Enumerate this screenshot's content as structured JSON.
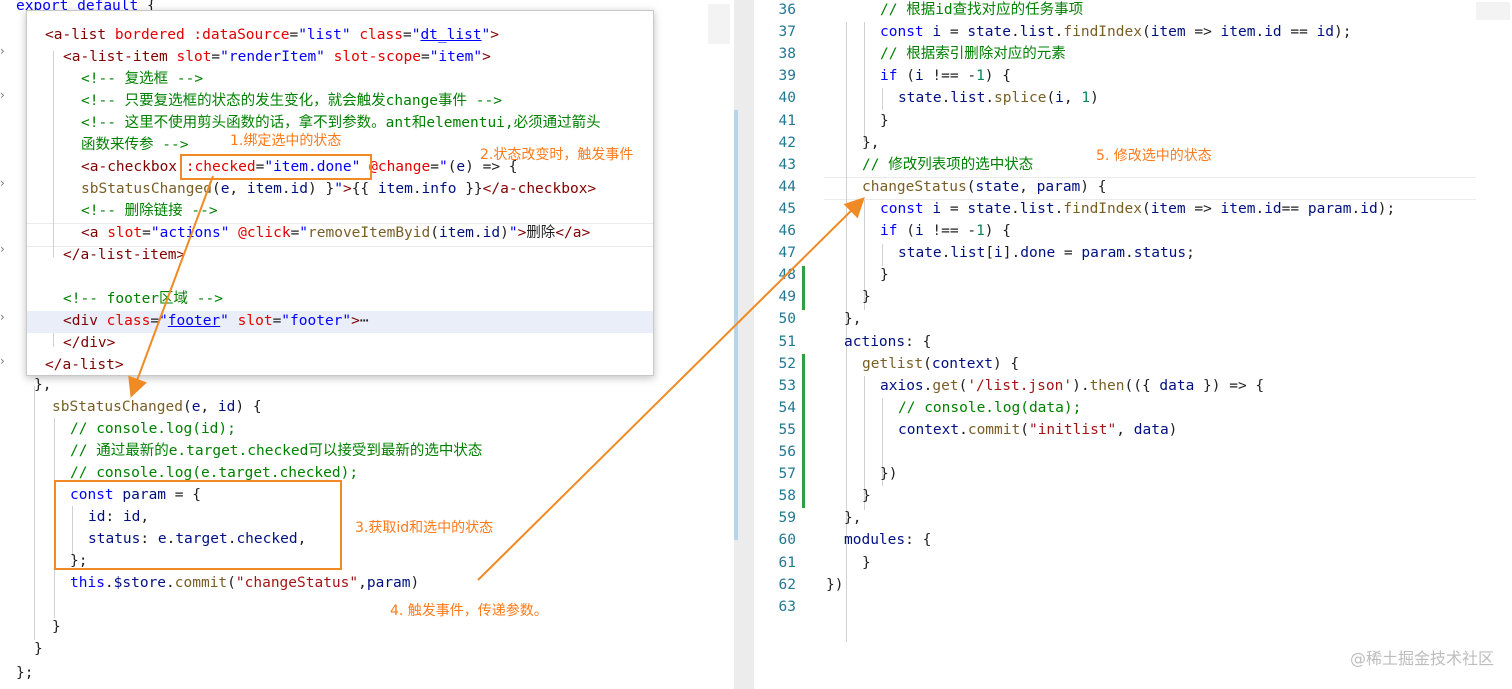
{
  "left_editor": {
    "top_line": [
      [
        "k",
        "export"
      ],
      [
        "p",
        " "
      ],
      [
        "k",
        "default"
      ],
      [
        "p",
        " {"
      ]
    ],
    "bottom_line": [
      [
        "p",
        "};"
      ]
    ],
    "method_lines": [
      [
        [
          "p",
          "},"
        ]
      ],
      [
        [
          "f",
          "sbStatusChanged"
        ],
        [
          "p",
          "("
        ],
        [
          "v",
          "e"
        ],
        [
          "p",
          ", "
        ],
        [
          "v",
          "id"
        ],
        [
          "p",
          ") {"
        ]
      ],
      [
        [
          "c",
          "// console.log(id);"
        ]
      ],
      [
        [
          "c",
          "// 通过最新的e.target.checked可以接受到最新的选中状态"
        ]
      ],
      [
        [
          "c",
          "// console.log(e.target.checked);"
        ]
      ],
      [
        [
          "k",
          "const"
        ],
        [
          "p",
          " "
        ],
        [
          "v",
          "param"
        ],
        [
          "p",
          " = {"
        ]
      ],
      [
        [
          "v",
          "id"
        ],
        [
          "p",
          ": "
        ],
        [
          "v",
          "id"
        ],
        [
          "p",
          ","
        ]
      ],
      [
        [
          "v",
          "status"
        ],
        [
          "p",
          ": "
        ],
        [
          "v",
          "e"
        ],
        [
          "p",
          "."
        ],
        [
          "v",
          "target"
        ],
        [
          "p",
          "."
        ],
        [
          "v",
          "checked"
        ],
        [
          "p",
          ","
        ]
      ],
      [
        [
          "p",
          "};"
        ]
      ],
      [
        [
          "k",
          "this"
        ],
        [
          "p",
          "."
        ],
        [
          "v",
          "$store"
        ],
        [
          "p",
          "."
        ],
        [
          "f",
          "commit"
        ],
        [
          "p",
          "("
        ],
        [
          "s",
          "\"changeStatus\""
        ],
        [
          "p",
          ","
        ],
        [
          "v",
          "param"
        ],
        [
          "p",
          ")"
        ]
      ],
      [
        [
          "p",
          ""
        ]
      ],
      [
        [
          "p",
          "}"
        ]
      ],
      [
        [
          "p",
          "}"
        ]
      ]
    ]
  },
  "popup": {
    "lines": [
      [
        [
          "t",
          "<a-list"
        ],
        [
          "p",
          " "
        ],
        [
          "a",
          "bordered"
        ],
        [
          "p",
          " "
        ],
        [
          "a",
          ":dataSource"
        ],
        [
          "p",
          "="
        ],
        [
          "k",
          "\"list\""
        ],
        [
          "p",
          " "
        ],
        [
          "a",
          "class"
        ],
        [
          "p",
          "="
        ],
        [
          "k",
          "\""
        ],
        [
          "ku",
          "dt_list"
        ],
        [
          "k",
          "\""
        ],
        [
          "t",
          ">"
        ]
      ],
      [
        [
          "t",
          "<a-list-item"
        ],
        [
          "p",
          " "
        ],
        [
          "a",
          "slot"
        ],
        [
          "p",
          "="
        ],
        [
          "k",
          "\"renderItem\""
        ],
        [
          "p",
          " "
        ],
        [
          "a",
          "slot-scope"
        ],
        [
          "p",
          "="
        ],
        [
          "k",
          "\"item\""
        ],
        [
          "t",
          ">"
        ]
      ],
      [
        [
          "c",
          "<!-- 复选框 -->"
        ]
      ],
      [
        [
          "c",
          "<!-- 只要复选框的状态的发生变化，就会触发change事件 -->"
        ]
      ],
      [
        [
          "c",
          "<!-- 这里不使用剪头函数的话，拿不到参数。ant和elementui,必须通过箭头"
        ]
      ],
      [
        [
          "c",
          "函数来传参 -->"
        ]
      ],
      [
        [
          "t",
          "<a-checkbox"
        ],
        [
          "p",
          " "
        ],
        [
          "a",
          ":checked"
        ],
        [
          "p",
          "="
        ],
        [
          "k",
          "\"item.done\""
        ],
        [
          "p",
          " "
        ],
        [
          "a",
          "@change"
        ],
        [
          "p",
          "="
        ],
        [
          "k",
          "\""
        ],
        [
          "p",
          "("
        ],
        [
          "v",
          "e"
        ],
        [
          "p",
          ") => {"
        ]
      ],
      [
        [
          "f",
          "sbStatusChanged"
        ],
        [
          "p",
          "("
        ],
        [
          "v",
          "e"
        ],
        [
          "p",
          ", "
        ],
        [
          "v",
          "item"
        ],
        [
          "p",
          "."
        ],
        [
          "v",
          "id"
        ],
        [
          "p",
          ") }"
        ],
        [
          "k",
          "\""
        ],
        [
          "t",
          ">"
        ],
        [
          "p",
          "{{ "
        ],
        [
          "v",
          "item"
        ],
        [
          "p",
          "."
        ],
        [
          "v",
          "info"
        ],
        [
          "p",
          " }}"
        ],
        [
          "t",
          "</a-checkbox>"
        ]
      ],
      [
        [
          "c",
          "<!-- 删除链接 -->"
        ]
      ],
      [
        [
          "t",
          "<a"
        ],
        [
          "p",
          " "
        ],
        [
          "a",
          "slot"
        ],
        [
          "p",
          "="
        ],
        [
          "k",
          "\"actions\""
        ],
        [
          "p",
          " "
        ],
        [
          "a",
          "@click"
        ],
        [
          "p",
          "="
        ],
        [
          "k",
          "\""
        ],
        [
          "f",
          "removeItemByid"
        ],
        [
          "p",
          "("
        ],
        [
          "v",
          "item"
        ],
        [
          "p",
          "."
        ],
        [
          "v",
          "id"
        ],
        [
          "p",
          ")"
        ],
        [
          "k",
          "\""
        ],
        [
          "t",
          ">"
        ],
        [
          "p",
          "删除"
        ],
        [
          "t",
          "</a>"
        ]
      ],
      [
        [
          "t",
          "</a-list-item>"
        ]
      ],
      [
        [
          "p",
          ""
        ]
      ],
      [
        [
          "c",
          "<!-- footer区域 -->"
        ]
      ],
      [
        [
          "t",
          "<div"
        ],
        [
          "p",
          " "
        ],
        [
          "a",
          "class"
        ],
        [
          "p",
          "="
        ],
        [
          "k",
          "\""
        ],
        [
          "ku",
          "footer"
        ],
        [
          "k",
          "\""
        ],
        [
          "p",
          " "
        ],
        [
          "a",
          "slot"
        ],
        [
          "p",
          "="
        ],
        [
          "k",
          "\"footer\""
        ],
        [
          "t",
          ">"
        ],
        [
          "p",
          "⋯"
        ]
      ],
      [
        [
          "t",
          "</div>"
        ]
      ],
      [
        [
          "t",
          "</a-list>"
        ]
      ]
    ]
  },
  "right_editor": {
    "line_numbers": [
      "36",
      "37",
      "38",
      "39",
      "40",
      "41",
      "42",
      "43",
      "44",
      "45",
      "46",
      "47",
      "48",
      "49",
      "50",
      "51",
      "52",
      "53",
      "54",
      "55",
      "56",
      "57",
      "58",
      "59",
      "60",
      "61",
      "62",
      "63"
    ],
    "lines": [
      [
        [
          "c",
          "// 根据id查找对应的任务事项"
        ]
      ],
      [
        [
          "k",
          "const"
        ],
        [
          "p",
          " "
        ],
        [
          "v",
          "i"
        ],
        [
          "p",
          " = "
        ],
        [
          "v",
          "state"
        ],
        [
          "p",
          "."
        ],
        [
          "v",
          "list"
        ],
        [
          "p",
          "."
        ],
        [
          "f",
          "findIndex"
        ],
        [
          "p",
          "("
        ],
        [
          "v",
          "item"
        ],
        [
          "p",
          " => "
        ],
        [
          "v",
          "item"
        ],
        [
          "p",
          "."
        ],
        [
          "v",
          "id"
        ],
        [
          "p",
          " == "
        ],
        [
          "v",
          "id"
        ],
        [
          "p",
          ");"
        ]
      ],
      [
        [
          "c",
          "// 根据索引删除对应的元素"
        ]
      ],
      [
        [
          "k",
          "if"
        ],
        [
          "p",
          " ("
        ],
        [
          "v",
          "i"
        ],
        [
          "p",
          " !== -"
        ],
        [
          "n",
          "1"
        ],
        [
          "p",
          ") {"
        ]
      ],
      [
        [
          "v",
          "state"
        ],
        [
          "p",
          "."
        ],
        [
          "v",
          "list"
        ],
        [
          "p",
          "."
        ],
        [
          "f",
          "splice"
        ],
        [
          "p",
          "("
        ],
        [
          "v",
          "i"
        ],
        [
          "p",
          ", "
        ],
        [
          "n",
          "1"
        ],
        [
          "p",
          ")"
        ]
      ],
      [
        [
          "p",
          "}"
        ]
      ],
      [
        [
          "p",
          "},"
        ]
      ],
      [
        [
          "c",
          "// 修改列表项的选中状态"
        ]
      ],
      [
        [
          "f",
          "changeStatus"
        ],
        [
          "p",
          "("
        ],
        [
          "v",
          "state"
        ],
        [
          "p",
          ", "
        ],
        [
          "v",
          "param"
        ],
        [
          "p",
          ") {"
        ]
      ],
      [
        [
          "k",
          "const"
        ],
        [
          "p",
          " "
        ],
        [
          "v",
          "i"
        ],
        [
          "p",
          " = "
        ],
        [
          "v",
          "state"
        ],
        [
          "p",
          "."
        ],
        [
          "v",
          "list"
        ],
        [
          "p",
          "."
        ],
        [
          "f",
          "findIndex"
        ],
        [
          "p",
          "("
        ],
        [
          "v",
          "item"
        ],
        [
          "p",
          " => "
        ],
        [
          "v",
          "item"
        ],
        [
          "p",
          "."
        ],
        [
          "v",
          "id"
        ],
        [
          "p",
          "== "
        ],
        [
          "v",
          "param"
        ],
        [
          "p",
          "."
        ],
        [
          "v",
          "id"
        ],
        [
          "p",
          ");"
        ]
      ],
      [
        [
          "k",
          "if"
        ],
        [
          "p",
          " ("
        ],
        [
          "v",
          "i"
        ],
        [
          "p",
          " !== -"
        ],
        [
          "n",
          "1"
        ],
        [
          "p",
          ") {"
        ]
      ],
      [
        [
          "v",
          "state"
        ],
        [
          "p",
          "."
        ],
        [
          "v",
          "list"
        ],
        [
          "p",
          "["
        ],
        [
          "v",
          "i"
        ],
        [
          "p",
          "]."
        ],
        [
          "v",
          "done"
        ],
        [
          "p",
          " = "
        ],
        [
          "v",
          "param"
        ],
        [
          "p",
          "."
        ],
        [
          "v",
          "status"
        ],
        [
          "p",
          ";"
        ]
      ],
      [
        [
          "p",
          "}"
        ]
      ],
      [
        [
          "p",
          "}"
        ]
      ],
      [
        [
          "p",
          "},"
        ]
      ],
      [
        [
          "v",
          "actions"
        ],
        [
          "p",
          ": {"
        ]
      ],
      [
        [
          "f",
          "getlist"
        ],
        [
          "p",
          "("
        ],
        [
          "v",
          "context"
        ],
        [
          "p",
          ") {"
        ]
      ],
      [
        [
          "v",
          "axios"
        ],
        [
          "p",
          "."
        ],
        [
          "f",
          "get"
        ],
        [
          "p",
          "("
        ],
        [
          "s",
          "'/list.json'"
        ],
        [
          "p",
          ")."
        ],
        [
          "f",
          "then"
        ],
        [
          "p",
          "(({ "
        ],
        [
          "v",
          "data"
        ],
        [
          "p",
          " }) => {"
        ]
      ],
      [
        [
          "c",
          "// console.log(data);"
        ]
      ],
      [
        [
          "v",
          "context"
        ],
        [
          "p",
          "."
        ],
        [
          "f",
          "commit"
        ],
        [
          "p",
          "("
        ],
        [
          "s",
          "\"initlist\""
        ],
        [
          "p",
          ", "
        ],
        [
          "v",
          "data"
        ],
        [
          "p",
          ")"
        ]
      ],
      [
        [
          "p",
          ""
        ]
      ],
      [
        [
          "p",
          "})"
        ]
      ],
      [
        [
          "p",
          "}"
        ]
      ],
      [
        [
          "p",
          "},"
        ]
      ],
      [
        [
          "v",
          "modules"
        ],
        [
          "p",
          ": {"
        ]
      ],
      [
        [
          "p",
          "}"
        ]
      ],
      [
        [
          "p",
          "})"
        ]
      ],
      [
        [
          "p",
          ""
        ]
      ]
    ]
  },
  "annotations": [
    "1.绑定选中的状态",
    "2.状态改变时，触发事件",
    "3.获取id和选中的状态",
    "4. 触发事件，传递参数。",
    "5. 修改选中的状态"
  ],
  "watermark": "@稀土掘金技术社区",
  "accent_color": "#f08a24"
}
